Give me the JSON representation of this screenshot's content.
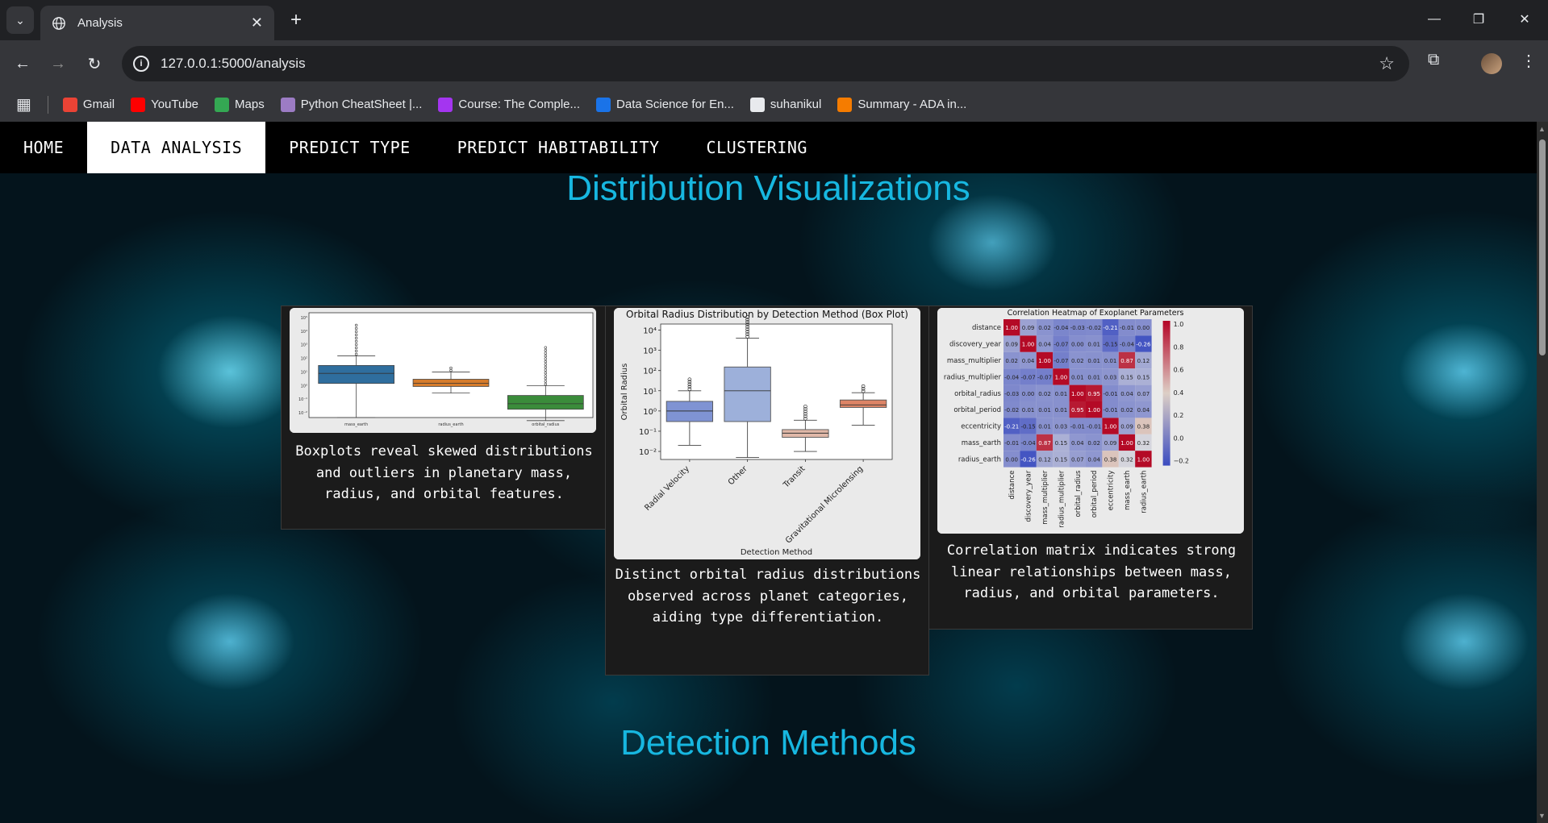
{
  "browser": {
    "tab_title": "Analysis",
    "url": "127.0.0.1:5000/analysis",
    "bookmarks": [
      {
        "label": "Gmail",
        "color": "#ea4335"
      },
      {
        "label": "YouTube",
        "color": "#ff0000"
      },
      {
        "label": "Maps",
        "color": "#34a853"
      },
      {
        "label": "Python CheatSheet |...",
        "color": "#9c7cc4"
      },
      {
        "label": "Course: The Comple...",
        "color": "#a435f0"
      },
      {
        "label": "Data Science for En...",
        "color": "#1a73e8"
      },
      {
        "label": "suhanikul",
        "color": "#e8eaed"
      },
      {
        "label": "Summary - ADA in...",
        "color": "#f57c00"
      }
    ]
  },
  "nav": {
    "items": [
      "HOME",
      "DATA ANALYSIS",
      "PREDICT TYPE",
      "PREDICT HABITABILITY",
      "CLUSTERING"
    ],
    "active": "DATA ANALYSIS"
  },
  "sections": {
    "distribution_title": "Distribution Visualizations",
    "detection_title": "Detection Methods"
  },
  "cards": [
    {
      "caption": "Boxplots reveal skewed distributions and outliers in planetary mass, radius, and orbital features."
    },
    {
      "caption": "Distinct orbital radius distributions observed across planet categories, aiding type differentiation."
    },
    {
      "caption": "Correlation matrix indicates strong linear relationships between mass, radius, and orbital parameters."
    }
  ],
  "chart_data": [
    {
      "type": "box",
      "title": "",
      "categories": [
        "mass_earth",
        "radius_earth",
        "orbital_radius"
      ],
      "scale": "log",
      "ytick_labels": [
        "10⁵",
        "10⁴",
        "10³",
        "10²",
        "10¹",
        "10⁰",
        "10⁻¹",
        "10⁻²"
      ],
      "colors": [
        "#2f6e9e",
        "#d57b2b",
        "#3b8c3b"
      ],
      "boxes": [
        {
          "q1": 1.5,
          "median": 8,
          "q3": 30,
          "whisker_low": 0.005,
          "whisker_high": 150
        },
        {
          "q1": 0.9,
          "median": 1.5,
          "q3": 3,
          "whisker_low": 0.3,
          "whisker_high": 10
        },
        {
          "q1": 0.02,
          "median": 0.05,
          "q3": 0.2,
          "whisker_low": 0.003,
          "whisker_high": 1
        }
      ]
    },
    {
      "type": "box",
      "title": "Orbital Radius Distribution by Detection Method (Box Plot)",
      "xlabel": "Detection Method",
      "ylabel": "Orbital Radius",
      "scale": "log",
      "ytick_labels": [
        "10⁴",
        "10³",
        "10²",
        "10¹",
        "10⁰",
        "10⁻¹",
        "10⁻²"
      ],
      "categories": [
        "Radial Velocity",
        "Other",
        "Transit",
        "Gravitational Microlensing"
      ],
      "colors": [
        "#7f93d3",
        "#9db0da",
        "#e0b8a8",
        "#dd8466"
      ],
      "boxes": [
        {
          "q1": 0.3,
          "median": 1,
          "q3": 3,
          "whisker_low": 0.02,
          "whisker_high": 10
        },
        {
          "q1": 0.3,
          "median": 10,
          "q3": 150,
          "whisker_low": 0.005,
          "whisker_high": 4000
        },
        {
          "q1": 0.05,
          "median": 0.08,
          "q3": 0.12,
          "whisker_low": 0.01,
          "whisker_high": 0.35
        },
        {
          "q1": 1.5,
          "median": 2,
          "q3": 3.5,
          "whisker_low": 0.2,
          "whisker_high": 8
        }
      ]
    },
    {
      "type": "heatmap",
      "title": "Correlation Heatmap of Exoplanet Parameters",
      "labels": [
        "distance",
        "discovery_year",
        "mass_multiplier",
        "radius_multiplier",
        "orbital_radius",
        "orbital_period",
        "eccentricity",
        "mass_earth",
        "radius_earth"
      ],
      "colorbar_ticks": [
        "1.0",
        "0.8",
        "0.6",
        "0.4",
        "0.2",
        "0.0",
        "−0.2"
      ],
      "matrix": [
        [
          "1.00",
          "0.09",
          "0.02",
          "-0.04",
          "-0.03",
          "-0.02",
          "-0.21",
          "-0.01",
          "0.00"
        ],
        [
          "0.09",
          "1.00",
          "0.04",
          "-0.07",
          "0.00",
          "0.01",
          "-0.15",
          "-0.04",
          "-0.26"
        ],
        [
          "0.02",
          "0.04",
          "1.00",
          "-0.07",
          "0.02",
          "0.01",
          "0.01",
          "0.87",
          "0.12"
        ],
        [
          "-0.04",
          "-0.07",
          "-0.07",
          "1.00",
          "0.01",
          "0.01",
          "0.03",
          "0.15",
          "0.15"
        ],
        [
          "-0.03",
          "0.00",
          "0.02",
          "0.01",
          "1.00",
          "0.95",
          "-0.01",
          "0.04",
          "0.07"
        ],
        [
          "-0.02",
          "0.01",
          "0.01",
          "0.01",
          "0.95",
          "1.00",
          "-0.01",
          "0.02",
          "0.04"
        ],
        [
          "-0.21",
          "-0.15",
          "0.01",
          "0.03",
          "-0.01",
          "-0.01",
          "1.00",
          "0.09",
          "0.38"
        ],
        [
          "-0.01",
          "-0.04",
          "0.87",
          "0.15",
          "0.04",
          "0.02",
          "0.09",
          "1.00",
          "0.32"
        ],
        [
          "0.00",
          "-0.26",
          "0.12",
          "0.15",
          "0.07",
          "0.04",
          "0.38",
          "0.32",
          "1.00"
        ]
      ]
    }
  ]
}
